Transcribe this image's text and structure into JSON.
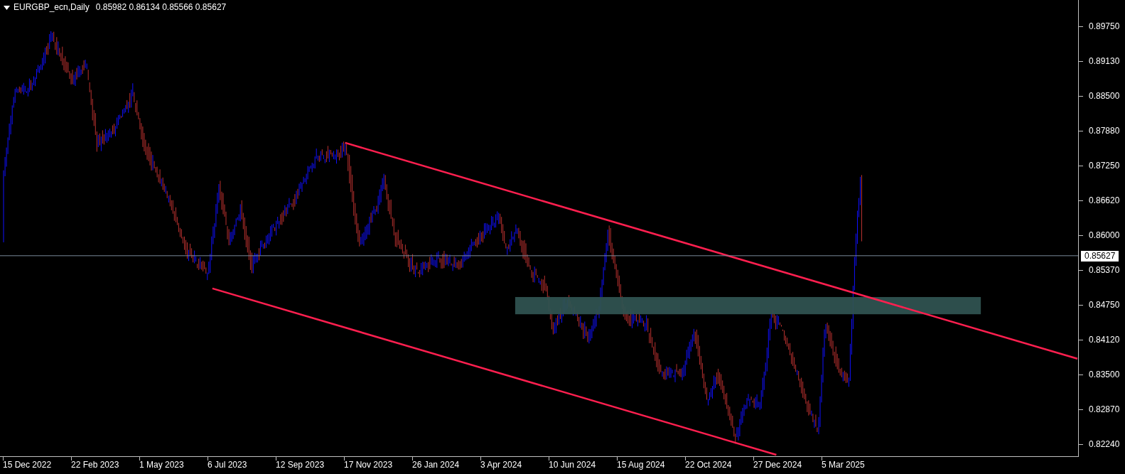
{
  "header": {
    "symbol": "EURGBP_ecn,Daily",
    "ohlc": "0.85982 0.86134 0.85566 0.85627"
  },
  "price_axis": [
    "0.89750",
    "0.89130",
    "0.88500",
    "0.87880",
    "0.87250",
    "0.86620",
    "0.86000",
    "0.85370",
    "0.84750",
    "0.84120",
    "0.83500",
    "0.82870",
    "0.82240"
  ],
  "current_price": "0.85627",
  "time_axis": [
    "15 Dec 2022",
    "22 Feb 2023",
    "1 May 2023",
    "6 Jul 2023",
    "12 Sep 2023",
    "17 Nov 2023",
    "26 Jan 2024",
    "3 Apr 2024",
    "10 Jun 2024",
    "15 Aug 2024",
    "22 Oct 2024",
    "27 Dec 2024",
    "5 Mar 2025"
  ]
}
